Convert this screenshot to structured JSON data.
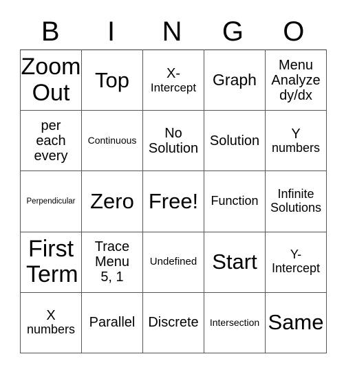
{
  "header": [
    "B",
    "I",
    "N",
    "G",
    "O"
  ],
  "cells": [
    [
      "Zoom Out",
      "Top",
      "X- Intercept",
      "Graph",
      "Menu Analyze dy/dx"
    ],
    [
      "per each every",
      "Continuous",
      "No Solution",
      "Solution",
      "Y numbers"
    ],
    [
      "Perpendicular",
      "Zero",
      "Free!",
      "Function",
      "Infinite Solutions"
    ],
    [
      "First Term",
      "Trace Menu 5, 1",
      "Undefined",
      "Start",
      "Y- Intercept"
    ],
    [
      "X numbers",
      "Parallel",
      "Discrete",
      "Intersection",
      "Same"
    ]
  ]
}
